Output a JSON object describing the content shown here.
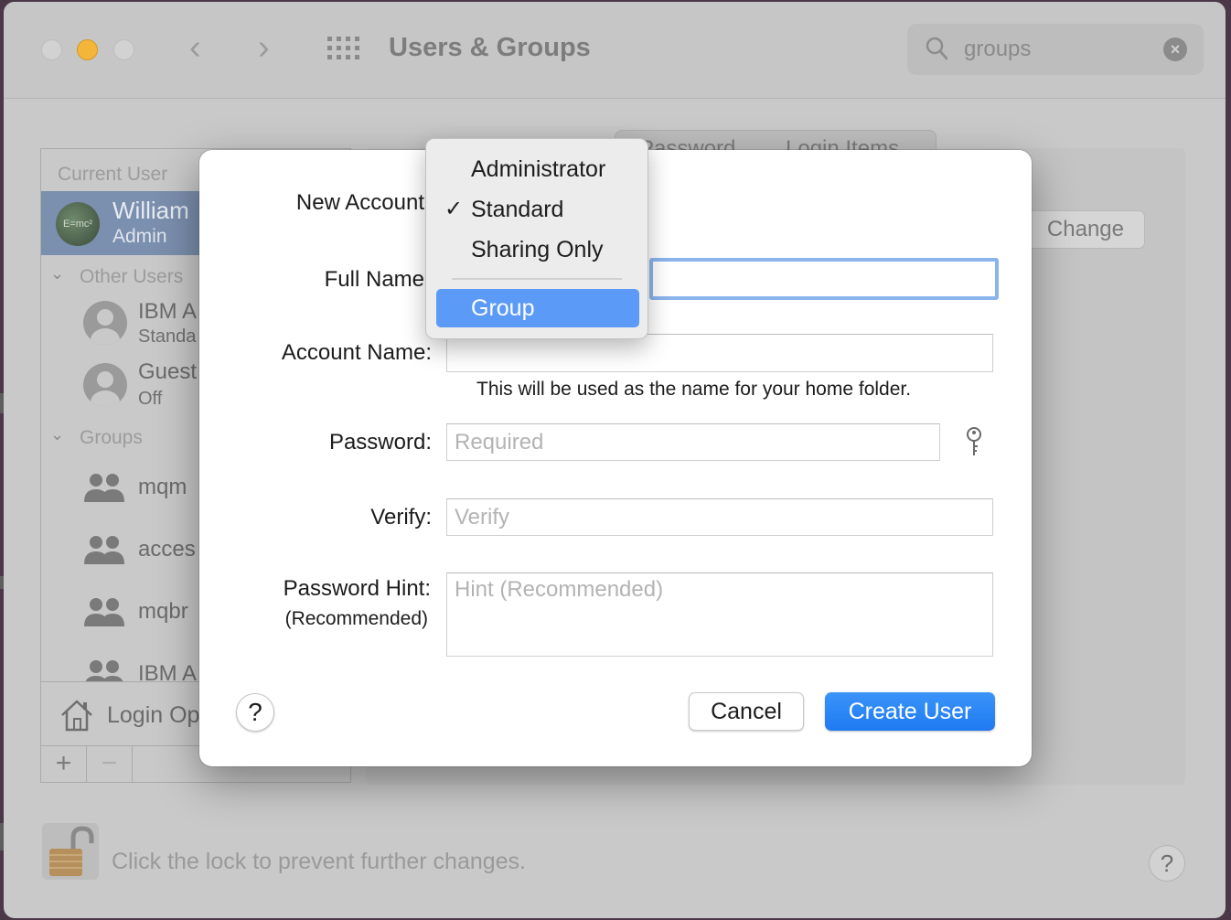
{
  "window": {
    "title": "Users & Groups",
    "search": {
      "value": "groups"
    }
  },
  "tabs": [
    {
      "label": "Password"
    },
    {
      "label": "Login Items"
    }
  ],
  "change_password_button": "Change Password...",
  "sidebar": {
    "current_user_header": "Current User",
    "current_user": {
      "name": "William",
      "role": "Admin"
    },
    "other_users_header": "Other Users",
    "other_users": [
      {
        "name": "IBM A",
        "role": "Standa"
      },
      {
        "name": "Guest",
        "role": "Off"
      }
    ],
    "groups_header": "Groups",
    "groups": [
      {
        "name": "mqm"
      },
      {
        "name": "acces"
      },
      {
        "name": "mqbr"
      },
      {
        "name": "IBM A"
      }
    ],
    "login_options": "Login Op",
    "add_button": "+",
    "remove_button": "−"
  },
  "lock_text": "Click the lock to prevent further changes.",
  "dialog": {
    "new_account_label": "New Account",
    "full_name_label": "Full Name",
    "account_name_label": "Account Name:",
    "account_name_hint": "This will be used as the name for your home folder.",
    "password_label": "Password:",
    "password_placeholder": "Required",
    "verify_label": "Verify:",
    "verify_placeholder": "Verify",
    "hint_label": "Password Hint:",
    "hint_sublabel": "(Recommended)",
    "hint_placeholder": "Hint (Recommended)",
    "help": "?",
    "cancel_button": "Cancel",
    "create_button": "Create User"
  },
  "account_type_menu": {
    "items": [
      {
        "label": "Administrator"
      },
      {
        "label": "Standard",
        "checked": "✓"
      },
      {
        "label": "Sharing Only"
      },
      {
        "label": "Group"
      }
    ],
    "highlighted": "Group"
  },
  "colors": {
    "accent": "#1f7af2",
    "menu_highlight": "#5b9af7",
    "focus_ring": "#8bb4ec"
  }
}
